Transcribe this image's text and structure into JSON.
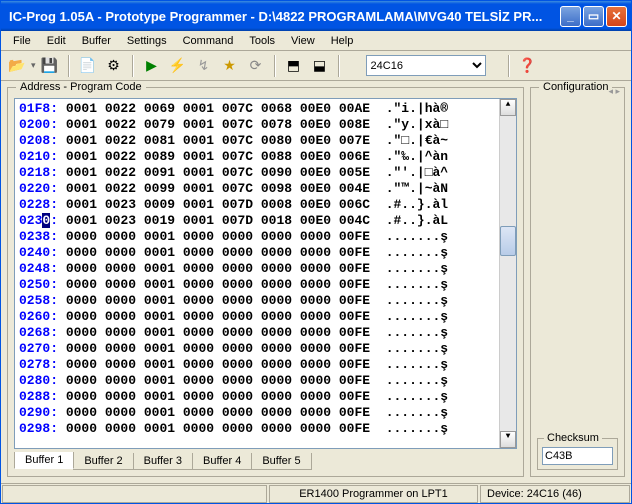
{
  "title": "IC-Prog 1.05A - Prototype Programmer - D:\\4822 PROGRAMLAMA\\MVG40 TELSİZ PR...",
  "menu": [
    "File",
    "Edit",
    "Buffer",
    "Settings",
    "Command",
    "Tools",
    "View",
    "Help"
  ],
  "device_select": "24C16",
  "panels": {
    "code_title": "Address - Program Code",
    "config_title": "Configuration",
    "checksum_label": "Checksum",
    "checksum_value": "C43B"
  },
  "buffers": [
    "Buffer 1",
    "Buffer 2",
    "Buffer 3",
    "Buffer 4",
    "Buffer 5"
  ],
  "active_buffer": 0,
  "status": {
    "left": "",
    "center": "ER1400 Programmer on LPT1",
    "right": "Device: 24C16  (46)"
  },
  "highlight_addr": "0230",
  "rows": [
    {
      "a": "01F8",
      "h": [
        "0001",
        "0022",
        "0069",
        "0001",
        "007C",
        "0068",
        "00E0",
        "00AE"
      ],
      "s": ".\"i.|hà®"
    },
    {
      "a": "0200",
      "h": [
        "0001",
        "0022",
        "0079",
        "0001",
        "007C",
        "0078",
        "00E0",
        "008E"
      ],
      "s": ".\"y.|xà□"
    },
    {
      "a": "0208",
      "h": [
        "0001",
        "0022",
        "0081",
        "0001",
        "007C",
        "0080",
        "00E0",
        "007E"
      ],
      "s": ".\"□.|€à~"
    },
    {
      "a": "0210",
      "h": [
        "0001",
        "0022",
        "0089",
        "0001",
        "007C",
        "0088",
        "00E0",
        "006E"
      ],
      "s": ".\"‰.|^àn"
    },
    {
      "a": "0218",
      "h": [
        "0001",
        "0022",
        "0091",
        "0001",
        "007C",
        "0090",
        "00E0",
        "005E"
      ],
      "s": ".\"'.|□à^"
    },
    {
      "a": "0220",
      "h": [
        "0001",
        "0022",
        "0099",
        "0001",
        "007C",
        "0098",
        "00E0",
        "004E"
      ],
      "s": ".\"™.|~àN"
    },
    {
      "a": "0228",
      "h": [
        "0001",
        "0023",
        "0009",
        "0001",
        "007D",
        "0008",
        "00E0",
        "006C"
      ],
      "s": ".#..}.àl"
    },
    {
      "a": "0230",
      "h": [
        "0001",
        "0023",
        "0019",
        "0001",
        "007D",
        "0018",
        "00E0",
        "004C"
      ],
      "s": ".#..}.àL"
    },
    {
      "a": "0238",
      "h": [
        "0000",
        "0000",
        "0001",
        "0000",
        "0000",
        "0000",
        "0000",
        "00FE"
      ],
      "s": ".......ş"
    },
    {
      "a": "0240",
      "h": [
        "0000",
        "0000",
        "0001",
        "0000",
        "0000",
        "0000",
        "0000",
        "00FE"
      ],
      "s": ".......ş"
    },
    {
      "a": "0248",
      "h": [
        "0000",
        "0000",
        "0001",
        "0000",
        "0000",
        "0000",
        "0000",
        "00FE"
      ],
      "s": ".......ş"
    },
    {
      "a": "0250",
      "h": [
        "0000",
        "0000",
        "0001",
        "0000",
        "0000",
        "0000",
        "0000",
        "00FE"
      ],
      "s": ".......ş"
    },
    {
      "a": "0258",
      "h": [
        "0000",
        "0000",
        "0001",
        "0000",
        "0000",
        "0000",
        "0000",
        "00FE"
      ],
      "s": ".......ş"
    },
    {
      "a": "0260",
      "h": [
        "0000",
        "0000",
        "0001",
        "0000",
        "0000",
        "0000",
        "0000",
        "00FE"
      ],
      "s": ".......ş"
    },
    {
      "a": "0268",
      "h": [
        "0000",
        "0000",
        "0001",
        "0000",
        "0000",
        "0000",
        "0000",
        "00FE"
      ],
      "s": ".......ş"
    },
    {
      "a": "0270",
      "h": [
        "0000",
        "0000",
        "0001",
        "0000",
        "0000",
        "0000",
        "0000",
        "00FE"
      ],
      "s": ".......ş"
    },
    {
      "a": "0278",
      "h": [
        "0000",
        "0000",
        "0001",
        "0000",
        "0000",
        "0000",
        "0000",
        "00FE"
      ],
      "s": ".......ş"
    },
    {
      "a": "0280",
      "h": [
        "0000",
        "0000",
        "0001",
        "0000",
        "0000",
        "0000",
        "0000",
        "00FE"
      ],
      "s": ".......ş"
    },
    {
      "a": "0288",
      "h": [
        "0000",
        "0000",
        "0001",
        "0000",
        "0000",
        "0000",
        "0000",
        "00FE"
      ],
      "s": ".......ş"
    },
    {
      "a": "0290",
      "h": [
        "0000",
        "0000",
        "0001",
        "0000",
        "0000",
        "0000",
        "0000",
        "00FE"
      ],
      "s": ".......ş"
    },
    {
      "a": "0298",
      "h": [
        "0000",
        "0000",
        "0001",
        "0000",
        "0000",
        "0000",
        "0000",
        "00FE"
      ],
      "s": ".......ş"
    }
  ]
}
